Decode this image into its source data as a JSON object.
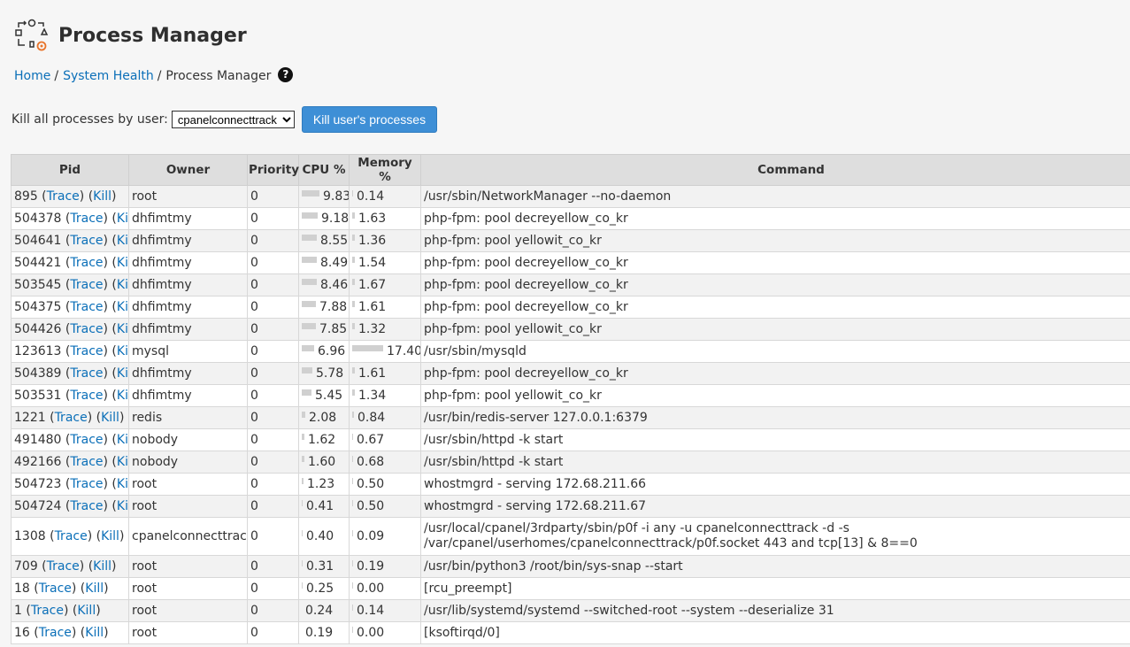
{
  "page": {
    "title": "Process Manager"
  },
  "breadcrumb": {
    "home": "Home",
    "health": "System Health",
    "current": "Process Manager"
  },
  "killbar": {
    "label": "Kill all processes by user:",
    "selected_user": "cpanelconnecttrack",
    "button": "Kill user's processes"
  },
  "table": {
    "headers": {
      "pid": "Pid",
      "owner": "Owner",
      "priority": "Priority",
      "cpu": "CPU %",
      "memory": "Memory %",
      "command": "Command"
    },
    "trace_label": "Trace",
    "kill_label": "Kill",
    "rows": [
      {
        "pid": "895",
        "owner": "root",
        "priority": "0",
        "cpu": 9.83,
        "cpu_text": "9.83",
        "mem": 0.14,
        "mem_text": "0.14",
        "command": "/usr/sbin/NetworkManager --no-daemon"
      },
      {
        "pid": "504378",
        "owner": "dhfimtmy",
        "priority": "0",
        "cpu": 9.18,
        "cpu_text": "9.18",
        "mem": 1.63,
        "mem_text": "1.63",
        "command": "php-fpm: pool decreyellow_co_kr"
      },
      {
        "pid": "504641",
        "owner": "dhfimtmy",
        "priority": "0",
        "cpu": 8.55,
        "cpu_text": "8.55",
        "mem": 1.36,
        "mem_text": "1.36",
        "command": "php-fpm: pool yellowit_co_kr"
      },
      {
        "pid": "504421",
        "owner": "dhfimtmy",
        "priority": "0",
        "cpu": 8.49,
        "cpu_text": "8.49",
        "mem": 1.54,
        "mem_text": "1.54",
        "command": "php-fpm: pool decreyellow_co_kr"
      },
      {
        "pid": "503545",
        "owner": "dhfimtmy",
        "priority": "0",
        "cpu": 8.46,
        "cpu_text": "8.46",
        "mem": 1.67,
        "mem_text": "1.67",
        "command": "php-fpm: pool decreyellow_co_kr"
      },
      {
        "pid": "504375",
        "owner": "dhfimtmy",
        "priority": "0",
        "cpu": 7.88,
        "cpu_text": "7.88",
        "mem": 1.61,
        "mem_text": "1.61",
        "command": "php-fpm: pool decreyellow_co_kr"
      },
      {
        "pid": "504426",
        "owner": "dhfimtmy",
        "priority": "0",
        "cpu": 7.85,
        "cpu_text": "7.85",
        "mem": 1.32,
        "mem_text": "1.32",
        "command": "php-fpm: pool yellowit_co_kr"
      },
      {
        "pid": "123613",
        "owner": "mysql",
        "priority": "0",
        "cpu": 6.96,
        "cpu_text": "6.96",
        "mem": 17.4,
        "mem_text": "17.40",
        "command": "/usr/sbin/mysqld"
      },
      {
        "pid": "504389",
        "owner": "dhfimtmy",
        "priority": "0",
        "cpu": 5.78,
        "cpu_text": "5.78",
        "mem": 1.61,
        "mem_text": "1.61",
        "command": "php-fpm: pool decreyellow_co_kr"
      },
      {
        "pid": "503531",
        "owner": "dhfimtmy",
        "priority": "0",
        "cpu": 5.45,
        "cpu_text": "5.45",
        "mem": 1.34,
        "mem_text": "1.34",
        "command": "php-fpm: pool yellowit_co_kr"
      },
      {
        "pid": "1221",
        "owner": "redis",
        "priority": "0",
        "cpu": 2.08,
        "cpu_text": "2.08",
        "mem": 0.84,
        "mem_text": "0.84",
        "command": "/usr/bin/redis-server 127.0.0.1:6379"
      },
      {
        "pid": "491480",
        "owner": "nobody",
        "priority": "0",
        "cpu": 1.62,
        "cpu_text": "1.62",
        "mem": 0.67,
        "mem_text": "0.67",
        "command": "/usr/sbin/httpd -k start"
      },
      {
        "pid": "492166",
        "owner": "nobody",
        "priority": "0",
        "cpu": 1.6,
        "cpu_text": "1.60",
        "mem": 0.68,
        "mem_text": "0.68",
        "command": "/usr/sbin/httpd -k start"
      },
      {
        "pid": "504723",
        "owner": "root",
        "priority": "0",
        "cpu": 1.23,
        "cpu_text": "1.23",
        "mem": 0.5,
        "mem_text": "0.50",
        "command": "whostmgrd - serving 172.68.211.66"
      },
      {
        "pid": "504724",
        "owner": "root",
        "priority": "0",
        "cpu": 0.41,
        "cpu_text": "0.41",
        "mem": 0.5,
        "mem_text": "0.50",
        "command": "whostmgrd - serving 172.68.211.67"
      },
      {
        "pid": "1308",
        "owner": "cpanelconnecttrack",
        "priority": "0",
        "cpu": 0.4,
        "cpu_text": "0.40",
        "mem": 0.09,
        "mem_text": "0.09",
        "command": "/usr/local/cpanel/3rdparty/sbin/p0f -i any -u cpanelconnecttrack -d -s /var/cpanel/userhomes/cpanelconnecttrack/p0f.socket 443 and tcp[13] & 8==0",
        "tall": true
      },
      {
        "pid": "709",
        "owner": "root",
        "priority": "0",
        "cpu": 0.31,
        "cpu_text": "0.31",
        "mem": 0.19,
        "mem_text": "0.19",
        "command": "/usr/bin/python3 /root/bin/sys-snap --start"
      },
      {
        "pid": "18",
        "owner": "root",
        "priority": "0",
        "cpu": 0.25,
        "cpu_text": "0.25",
        "mem": 0.0,
        "mem_text": "0.00",
        "command": "[rcu_preempt]"
      },
      {
        "pid": "1",
        "owner": "root",
        "priority": "0",
        "cpu": 0.24,
        "cpu_text": "0.24",
        "mem": 0.14,
        "mem_text": "0.14",
        "command": "/usr/lib/systemd/systemd --switched-root --system --deserialize 31"
      },
      {
        "pid": "16",
        "owner": "root",
        "priority": "0",
        "cpu": 0.19,
        "cpu_text": "0.19",
        "mem": 0.0,
        "mem_text": "0.00",
        "command": "[ksoftirqd/0]"
      }
    ]
  }
}
